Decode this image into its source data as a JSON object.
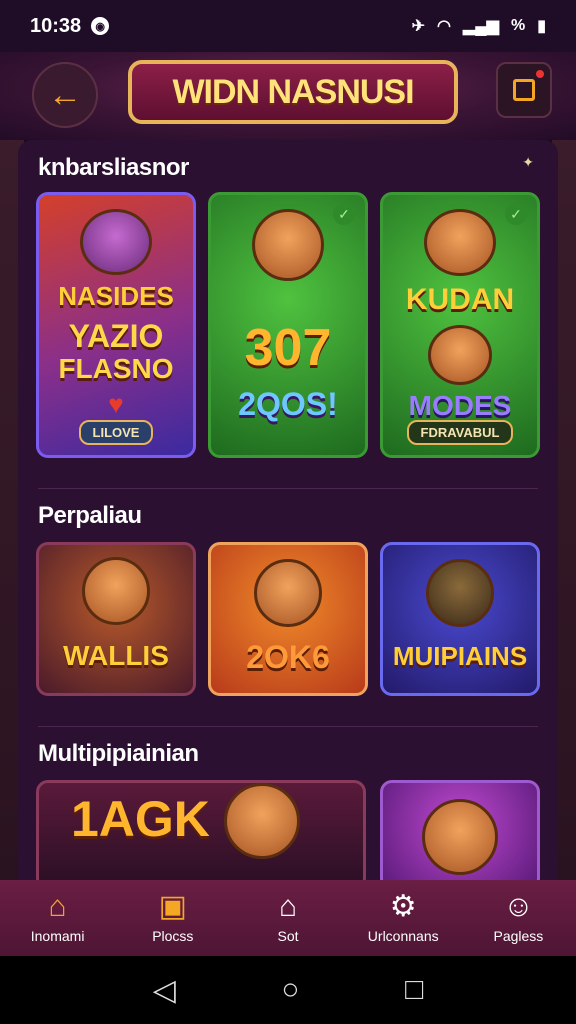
{
  "status": {
    "time": "10:38",
    "battery": "%"
  },
  "header": {
    "title": "WIDN NASNUSI"
  },
  "sections": [
    {
      "title": "knbarsliasnor",
      "cards": [
        {
          "line1": "NASIDES",
          "line2": "YAZIO",
          "line3": "FLASNO",
          "pill": "LILOVE"
        },
        {
          "line1": "307",
          "line2": "2QOS!"
        },
        {
          "line1": "KUDAN",
          "line2": "MODES",
          "pill": "FDRAVABUL"
        }
      ]
    },
    {
      "title": "Perpaliau",
      "cards": [
        {
          "label": "WALLIS"
        },
        {
          "label": "2OK6"
        },
        {
          "label": "MUIPIAINS"
        }
      ]
    },
    {
      "title": "Multipipiainian",
      "cards": [
        {
          "label": "1AGK"
        },
        {
          "label": ""
        }
      ]
    }
  ],
  "nav": [
    {
      "label": "Inomami",
      "icon": "home-icon"
    },
    {
      "label": "Plocss",
      "icon": "ticket-icon"
    },
    {
      "label": "Sot",
      "icon": "house-icon"
    },
    {
      "label": "Urlconnans",
      "icon": "gear-icon"
    },
    {
      "label": "Pagless",
      "icon": "profile-icon"
    }
  ],
  "colors": {
    "accent": "#f5a623",
    "nav_bg": "#5a1a3c",
    "panel_bg": "#2c1032"
  }
}
